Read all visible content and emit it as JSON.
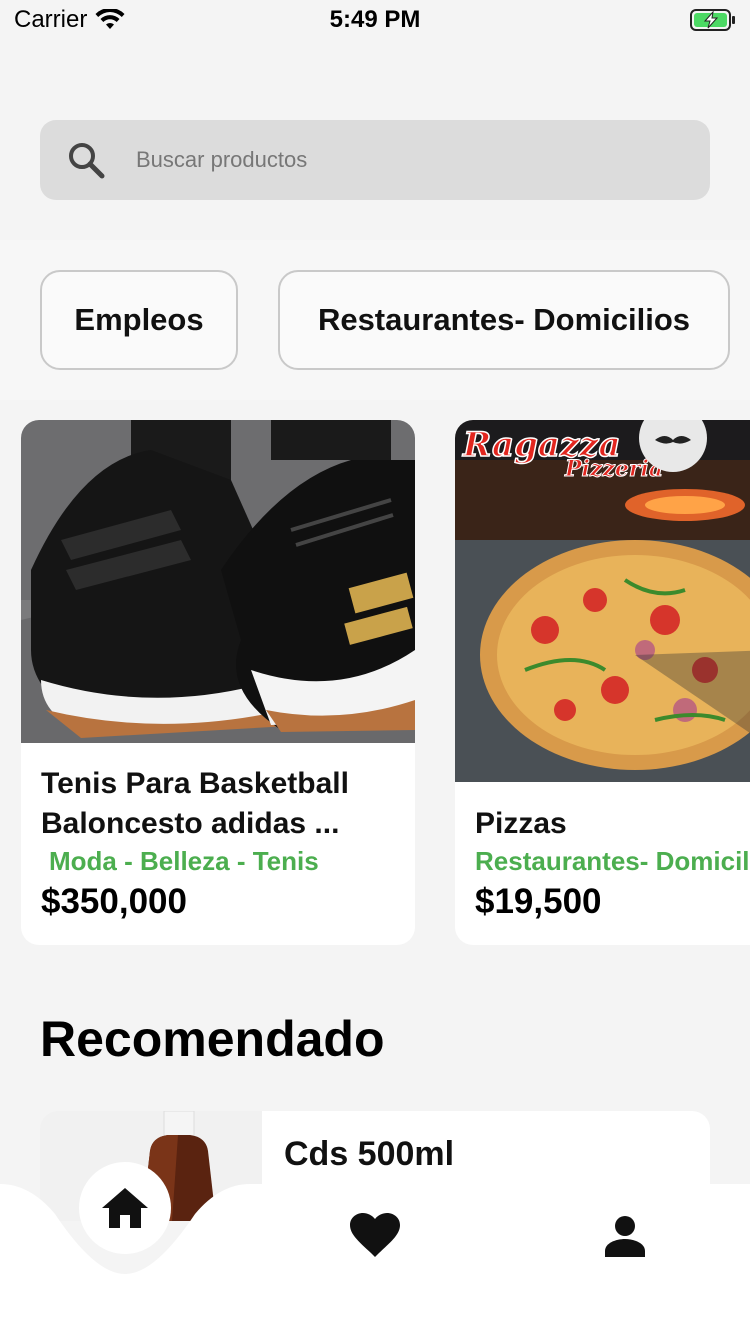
{
  "status_bar": {
    "carrier": "Carrier",
    "time": "5:49 PM"
  },
  "search": {
    "placeholder": "Buscar productos"
  },
  "categories": [
    {
      "label": "Empleos"
    },
    {
      "label": "Restaurantes- Domicilios"
    }
  ],
  "products": [
    {
      "title": "Tenis Para Basketball Baloncesto adidas ...",
      "category": "Moda - Belleza - Tenis",
      "price": "$350,000"
    },
    {
      "title": "Pizzas",
      "category": "Restaurantes- Domicilios",
      "price": "$19,500",
      "image_text_line1": "Ragazza",
      "image_text_line2": "Pizzeria"
    }
  ],
  "recommended": {
    "heading": "Recomendado",
    "items": [
      {
        "title": "Cds 500ml"
      }
    ]
  },
  "nav": {
    "items": [
      {
        "icon": "home-icon",
        "active": true
      },
      {
        "icon": "heart-icon",
        "active": false
      },
      {
        "icon": "person-icon",
        "active": false
      }
    ]
  },
  "colors": {
    "accent_green": "#4cae4f",
    "background": "#f4f4f4",
    "battery_green": "#4cd964"
  }
}
